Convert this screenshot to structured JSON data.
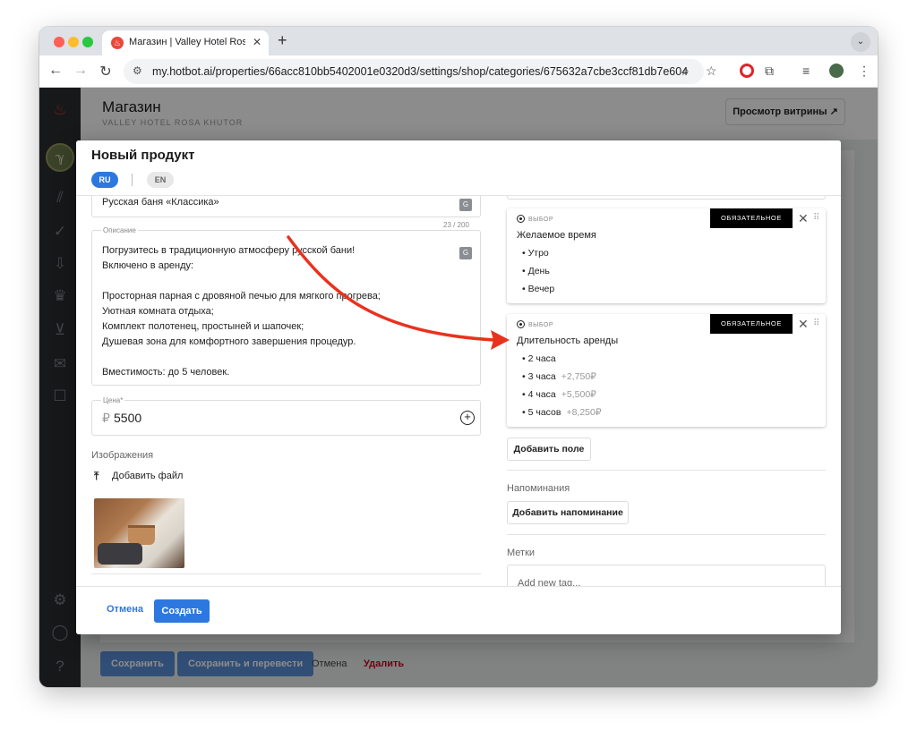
{
  "browser": {
    "tab_title": "Магазин | Valley Hotel Rosa Kh",
    "tab_favicon": "fire-icon",
    "url": "my.hotbot.ai/properties/66acc810bb5402001e0320d3/settings/shop/categories/675632a7cbe3ccf81db7e604"
  },
  "app": {
    "page_title": "Магазин",
    "page_subtitle": "VALLEY HOTEL ROSA KHUTOR",
    "preview_button": "Просмотр витрины ↗",
    "bottom_actions": {
      "save": "Сохранить",
      "save_translate": "Сохранить и перевести",
      "cancel": "Отмена",
      "delete": "Удалить"
    }
  },
  "modal": {
    "title": "Новый продукт",
    "lang_ru": "RU",
    "lang_en": "EN",
    "name_value": "Русская баня «Классика»",
    "name_counter": "23 / 200",
    "description_label": "Описание",
    "description_lines": [
      "Погрузитесь в традиционную атмосферу русской бани!",
      "Включено в аренду:",
      "",
      "Просторная парная с дровяной печью для мягкого прогрева;",
      "Уютная комната отдыха;",
      "Комплект полотенец, простыней и шапочек;",
      "Душевая зона для комфортного завершения процедур.",
      "",
      "Вместимость: до 5 человек."
    ],
    "price_label": "Цена*",
    "price_currency": "₽",
    "price_value": "5500",
    "images_label": "Изображения",
    "add_file_label": "Добавить файл",
    "choice_cards": [
      {
        "type_label": "ВЫБОР",
        "badge": "ОБЯЗАТЕЛЬНОЕ ПОЛЕ",
        "title": "Желаемое время",
        "options": [
          {
            "label": "• Утро",
            "price": ""
          },
          {
            "label": "• День",
            "price": ""
          },
          {
            "label": "• Вечер",
            "price": ""
          }
        ]
      },
      {
        "type_label": "ВЫБОР",
        "badge": "ОБЯЗАТЕЛЬНОЕ ПОЛЕ",
        "title": "Длительность аренды",
        "options": [
          {
            "label": "• 2 часа",
            "price": ""
          },
          {
            "label": "• 3 часа",
            "price": "+2,750₽"
          },
          {
            "label": "• 4 часа",
            "price": "+5,500₽"
          },
          {
            "label": "• 5 часов",
            "price": "+8,250₽"
          }
        ]
      }
    ],
    "add_field_button": "Добавить поле",
    "reminders_label": "Напоминания",
    "add_reminder_button": "Добавить напоминание",
    "tags_label": "Метки",
    "tags_placeholder": "Add new tag...",
    "cancel_button": "Отмена",
    "create_button": "Создать"
  },
  "colors": {
    "accent": "#2c78e0",
    "annotation_arrow": "#e8321e",
    "sidebar": "#2b2d30"
  }
}
